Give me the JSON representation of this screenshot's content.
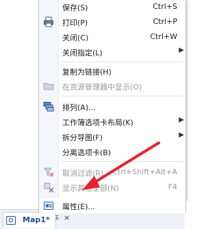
{
  "menu": {
    "items": [
      {
        "label": "保存(S)",
        "shortcut": "Ctrl+S",
        "icon": "none",
        "disabled": false,
        "submenu": false
      },
      {
        "label": "打印(P)",
        "shortcut": "Ctrl+P",
        "icon": "printer-icon",
        "disabled": false,
        "submenu": false
      },
      {
        "label": "关闭(C)",
        "shortcut": "Ctrl+W",
        "icon": "none",
        "disabled": false,
        "submenu": false
      },
      {
        "label": "关闭指定(L)",
        "shortcut": "",
        "icon": "none",
        "disabled": false,
        "submenu": true
      },
      {
        "label": "复制为链接(H)",
        "shortcut": "",
        "icon": "none",
        "disabled": false,
        "submenu": false
      },
      {
        "label": "在资源管理器中显示(O)",
        "shortcut": "",
        "icon": "folder-icon",
        "disabled": true,
        "submenu": false
      },
      {
        "label": "排列(A)...",
        "shortcut": "",
        "icon": "arrange-icon",
        "disabled": false,
        "submenu": false
      },
      {
        "label": "工作簿选项卡布局(K)",
        "shortcut": "",
        "icon": "none",
        "disabled": false,
        "submenu": true
      },
      {
        "label": "拆分导图(F)",
        "shortcut": "",
        "icon": "none",
        "disabled": false,
        "submenu": true
      },
      {
        "label": "分离选项卡(B)",
        "shortcut": "",
        "icon": "none",
        "disabled": false,
        "submenu": false
      },
      {
        "label": "取消过滤(R)",
        "shortcut": "Ctrl+Shift+Alt+A",
        "icon": "filter-icon",
        "disabled": true,
        "submenu": false
      },
      {
        "label": "显示其他全部(N)",
        "shortcut": "F4",
        "icon": "show-all-icon",
        "disabled": true,
        "submenu": false
      },
      {
        "label": "属性(E)...",
        "shortcut": "",
        "icon": "properties-icon",
        "disabled": false,
        "submenu": false
      }
    ]
  },
  "tab": {
    "label": "Map1*",
    "pin": "⊼",
    "close": "×"
  },
  "colors": {
    "arrow": "#e8232f",
    "tab_text": "#1f4f93",
    "disabled_text": "#9a9a9a"
  }
}
